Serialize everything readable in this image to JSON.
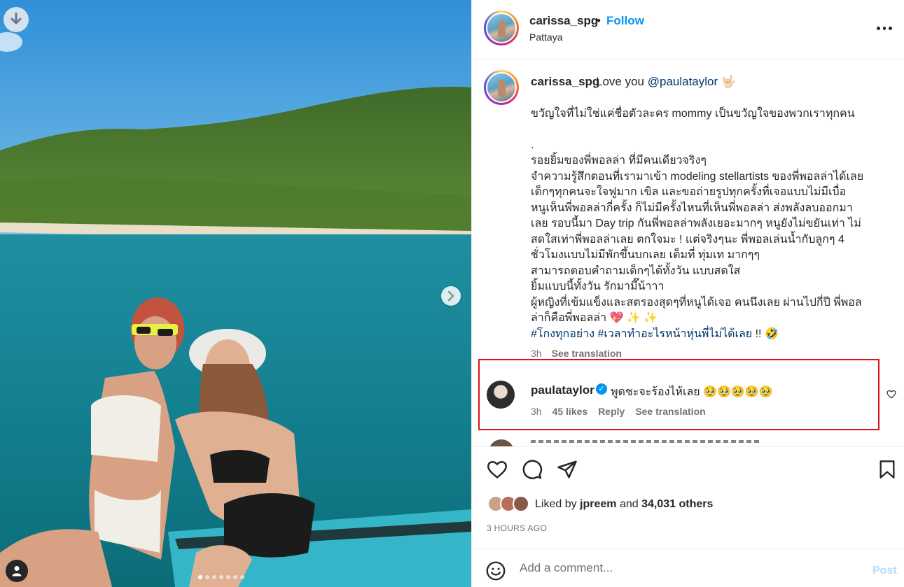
{
  "header": {
    "username": "carissa_spg",
    "separator": "•",
    "follow_label": "Follow",
    "location": "Pattaya"
  },
  "caption": {
    "username": "carissa_spg",
    "first_line_text": "Love you ",
    "mention": "@paulataylor",
    "first_line_emoji": "🤟🏻",
    "lines": [
      "ขวัญใจที่ไม่ใช่แค่ชื่อตัวละคร mommy เป็นขวัญใจของพวกเราทุกคน",
      "",
      ".",
      "รอยยิ้มของพี่พอลล่า ที่มีคนเดียวจริงๆ",
      "จำความรู้สึกตอนที่เรามาเข้า modeling stellartists ของพี่พอลล่าได้เลย",
      "เด็กๆทุกคนจะใจฟูมาก เขิล และขอถ่ายรูปทุกครั้งที่เจอแบบไม่มีเบื่อ",
      "หนูเห็นพี่พอลล่ากี่ครั้ง ก็ไม่มีครั้งไหนที่เห็นพี่พอลล่า ส่งพลังลบออกมา",
      "เลย รอบนี้มา Day trip กันพี่พอลล่าพลังเยอะมากๆ หนูยังไม่ขยันเท่า ไม่",
      "สดใสเท่าพี่พอลล่าเลย ตกใจมะ ! แต่จริงๆนะ พี่พอลเล่นน้ำกับลูกๆ 4",
      "ชั่วโมงแบบไม่มีพักขึ้นบกเลย เต็มที่ ทุ่มเท มากๆๆ",
      "สามารถตอบคำถามเด็กๆได้ทั้งวัน แบบสดใส",
      "ยิ้มแบบนี้ทั้งวัน รักมามี๊น้าาา",
      "ผู้หญิงที่เข้มแข็งและสตรองสุดๆที่หนูได้เจอ คนนึงเลย ผ่านไปกี่ปี พี่พอล",
      "ล่าก็คือพี่พอลล่า 💖 ✨ ✨"
    ],
    "hashtags": "#โกงทุกอย่าง #เวลาทำอะไรหน้าหุ่นพี่ไม่ได้เลย",
    "hashtags_suffix": " !! 🤣",
    "time": "3h",
    "see_translation": "See translation"
  },
  "comment": {
    "username": "paulataylor",
    "verified_icon": "✓",
    "text": "พูดชะจะร้องไห้เลย 🥹🥹🥹🥹🥹",
    "time": "3h",
    "likes": "45 likes",
    "reply": "Reply",
    "see_translation": "See translation"
  },
  "likes": {
    "prefix": "Liked by ",
    "user": "jpreem",
    "and": " and ",
    "others": "34,031 others"
  },
  "time_ago": "3 HOURS AGO",
  "add_comment": {
    "placeholder": "Add a comment...",
    "post_label": "Post"
  },
  "carousel": {
    "total": 7,
    "active_index": 0
  },
  "colors": {
    "link_blue": "#0095f6",
    "mention": "#00376b",
    "highlight_box": "#d9141b",
    "muted": "#737373"
  }
}
